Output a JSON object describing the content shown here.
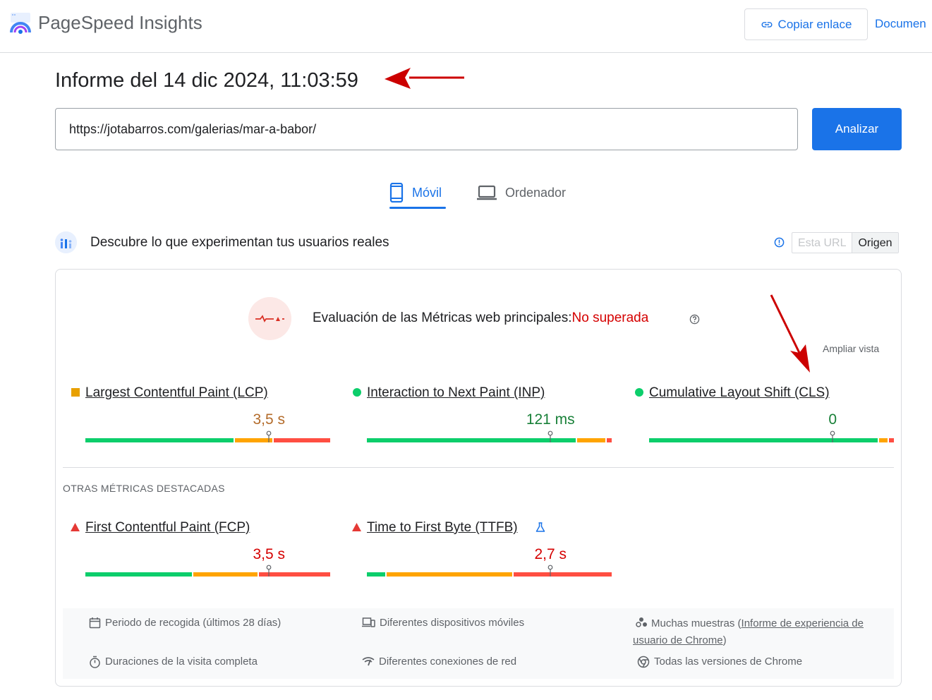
{
  "header": {
    "brand": "PageSpeed Insights",
    "copy_link": "Copiar enlace",
    "docs": "Documen"
  },
  "report": {
    "title": "Informe del 14 dic 2024, 11:03:59"
  },
  "url_input": {
    "value": "https://jotabarros.com/galerias/mar-a-babor/"
  },
  "analyze_button": "Analizar",
  "tabs": [
    {
      "label": "Móvil",
      "active": true,
      "icon": "phone-icon"
    },
    {
      "label": "Ordenador",
      "active": false,
      "icon": "laptop-icon"
    }
  ],
  "crux": {
    "title": "Descubre lo que experimentan tus usuarios reales",
    "toggle": [
      "Esta URL",
      "Origen"
    ],
    "selected": "Origen"
  },
  "assessment": {
    "label": "Evaluación de las Métricas web principales:",
    "status": "No superada",
    "expand": "Ampliar vista"
  },
  "colors": {
    "good": "#0cce6b",
    "needs_improvement": "#ffa400",
    "poor": "#ff4e42",
    "accent": "#1a73e8",
    "fail_text": "#d50000"
  },
  "core_metrics": [
    {
      "name": "Largest Contentful Paint (LCP)",
      "value": "3,5 s",
      "status": "average",
      "value_color": "#b36b2a",
      "distribution": [
        0.61,
        0.16,
        0.23
      ],
      "marker": 0.75
    },
    {
      "name": "Interaction to Next Paint (INP)",
      "value": "121 ms",
      "status": "good",
      "value_color": "#188038",
      "distribution": [
        0.86,
        0.12,
        0.02
      ],
      "marker": 0.75
    },
    {
      "name": "Cumulative Layout Shift (CLS)",
      "value": "0",
      "status": "good",
      "value_color": "#188038",
      "distribution": [
        0.94,
        0.04,
        0.02
      ],
      "marker": 0.75
    }
  ],
  "other_section_label": "OTRAS MÉTRICAS DESTACADAS",
  "other_metrics": [
    {
      "name": "First Contentful Paint (FCP)",
      "value": "3,5 s",
      "status": "poor",
      "value_color": "#d50000",
      "distribution": [
        0.44,
        0.27,
        0.29
      ],
      "marker": 0.75
    },
    {
      "name": "Time to First Byte (TTFB)",
      "value": "2,7 s",
      "status": "poor",
      "value_color": "#d50000",
      "distribution": [
        0.08,
        0.52,
        0.4
      ],
      "marker": 0.75,
      "experimental": true
    }
  ],
  "footer": {
    "collection_period": "Periodo de recogida (últimos 28 días)",
    "devices": "Diferentes dispositivos móviles",
    "samples_prefix": "Muchas muestras (",
    "samples_link": "Informe de experiencia de usuario de Chrome",
    "samples_suffix": ")",
    "visit_duration": "Duraciones de la visita completa",
    "connections": "Diferentes conexiones de red",
    "chrome_versions": "Todas las versiones de Chrome"
  }
}
